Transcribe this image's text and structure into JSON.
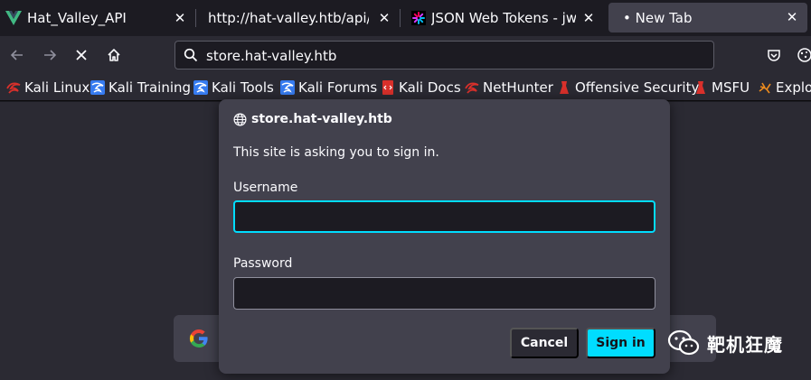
{
  "tabs": [
    {
      "title": "Hat_Valley_API",
      "icon": "vue-logo-icon",
      "active": false
    },
    {
      "title": "http://hat-valley.htb/api/store",
      "icon": "",
      "active": false
    },
    {
      "title": "JSON Web Tokens - jwt.io",
      "icon": "jwt-logo-icon",
      "active": false
    },
    {
      "title": "• New Tab",
      "icon": "",
      "active": true
    }
  ],
  "tab_close_glyph": "✕",
  "urlbar": {
    "value": "store.hat-valley.htb"
  },
  "bookmarks": [
    {
      "label": "Kali Linux",
      "icon": "kali-icon"
    },
    {
      "label": "Kali Training",
      "icon": "kali-training-icon"
    },
    {
      "label": "Kali Tools",
      "icon": "kali-tools-icon"
    },
    {
      "label": "Kali Forums",
      "icon": "kali-forums-icon"
    },
    {
      "label": "Kali Docs",
      "icon": "kali-docs-icon"
    },
    {
      "label": "NetHunter",
      "icon": "nethunter-icon"
    },
    {
      "label": "Offensive Security",
      "icon": "offsec-icon"
    },
    {
      "label": "MSFU",
      "icon": "msfu-icon"
    },
    {
      "label": "Explo",
      "icon": "exploit-db-icon"
    }
  ],
  "dialog": {
    "origin": "store.hat-valley.htb",
    "message": "This site is asking you to sign in.",
    "username_label": "Username",
    "username_value": "",
    "password_label": "Password",
    "password_value": "",
    "cancel_label": "Cancel",
    "signin_label": "Sign in"
  },
  "watermark": {
    "text": "靶机狂魔"
  },
  "colors": {
    "accent": "#00ddff",
    "dialog_bg": "#42414d",
    "toolbar_bg": "#2b2a33",
    "tabstrip_bg": "#1c1b22",
    "kali_red": "#d9302b",
    "vue_green": "#41b883"
  }
}
